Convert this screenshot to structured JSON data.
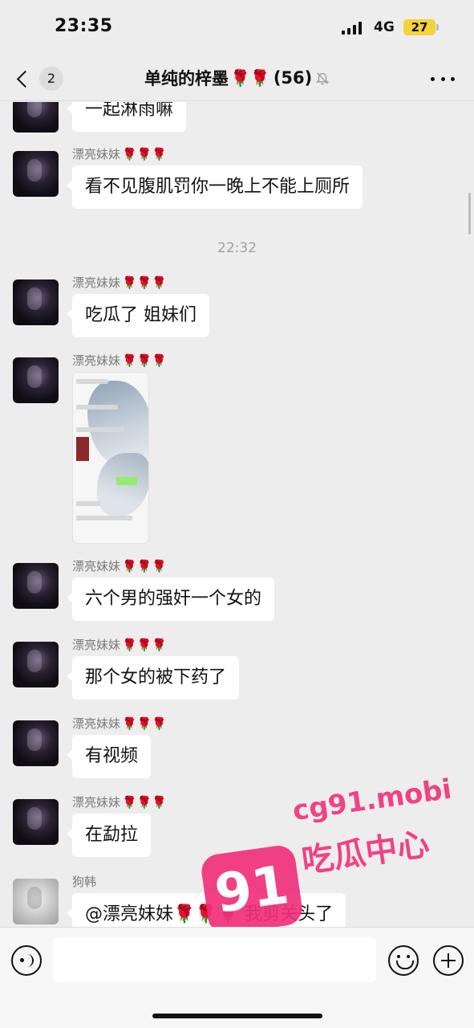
{
  "status_bar": {
    "time": "23:35",
    "network": "4G",
    "battery": "27"
  },
  "nav": {
    "back_count": "2",
    "title": "单纯的梓墨",
    "title_roses": "🌹🌹",
    "member_count": "(56)",
    "mute_icon": "bell-slash-icon",
    "more_icon": "ellipsis-icon"
  },
  "messages": [
    {
      "sender": "",
      "text": "一起淋雨嘛"
    },
    {
      "sender": "漂亮妹妹",
      "roses": "🌹🌹🌹",
      "text": "看不见腹肌罚你一晚上不能上厕所"
    },
    {
      "timestamp": "22:32"
    },
    {
      "sender": "漂亮妹妹",
      "roses": "🌹🌹🌹",
      "text": "吃瓜了 姐妹们"
    },
    {
      "sender": "漂亮妹妹",
      "roses": "🌹🌹🌹",
      "image": "chat-screenshot-image"
    },
    {
      "sender": "漂亮妹妹",
      "roses": "🌹🌹🌹",
      "text": "六个男的强奸一个女的"
    },
    {
      "sender": "漂亮妹妹",
      "roses": "🌹🌹🌹",
      "text": "那个女的被下药了"
    },
    {
      "sender": "漂亮妹妹",
      "roses": "🌹🌹🌹",
      "text": "有视频"
    },
    {
      "sender": "漂亮妹妹",
      "roses": "🌹🌹🌹",
      "text": "在勐拉"
    },
    {
      "sender": "狗韩",
      "text": "@漂亮妹妹🌹🌹🌹 我剪关头了"
    }
  ],
  "input_bar": {
    "voice_icon": "voice-icon",
    "emoji_icon": "emoji-icon",
    "plus_icon": "plus-icon"
  },
  "watermark": {
    "number": "91",
    "domain": "cg91.mobi",
    "text": "吃瓜中心",
    "color": "#f1307a"
  }
}
